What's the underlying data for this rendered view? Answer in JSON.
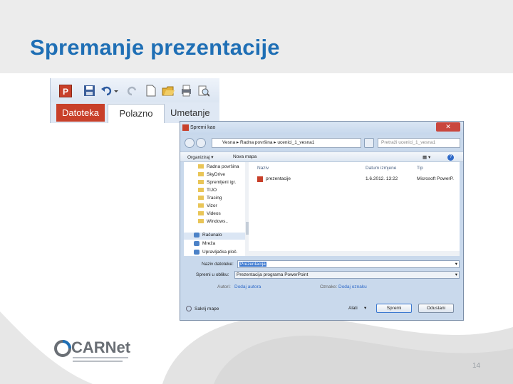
{
  "slide": {
    "title": "Spremanje prezentacije",
    "page_number": "14",
    "logo": "CARNet",
    "accent": "#1f6fb5"
  },
  "ribbon": {
    "app_icon": "powerpoint-icon",
    "quick_access_icons": [
      "save-icon",
      "undo-icon",
      "redo-icon",
      "new-icon",
      "open-icon",
      "print-icon",
      "print-preview-icon"
    ],
    "tabs": [
      "Datoteka",
      "Polazno",
      "Umetanje"
    ],
    "file_tab_color": "#c8402a"
  },
  "dialog": {
    "title": "Spremi kao",
    "address_path": "Vesna ▸ Radna površina ▸ ucenici_1_vesna1",
    "search_placeholder": "Pretraži ucenici_1_vesna1",
    "toolbar": {
      "organize": "Organiziraj ▾",
      "new_folder": "Nova mapa"
    },
    "tree_items": [
      "Radna površina",
      "SkyDrive",
      "Spremljeni igr.",
      "TIJO",
      "Tracing",
      "Vizor",
      "Videos",
      "Windows..",
      "Računalo",
      "Mreža",
      "Upravljačka ploč."
    ],
    "columns": [
      "Naziv",
      "Datum izmjene",
      "Tip"
    ],
    "files": [
      {
        "name": "prezentacije",
        "date": "1.6.2012. 13:22",
        "type": "Microsoft PowerP."
      }
    ],
    "file_name_label": "Naziv datoteke:",
    "file_name_value": "Prezentacija",
    "save_type_label": "Spremi u obliku:",
    "save_type_value": "Prezentacija programa PowerPoint",
    "authors_label": "Autori:",
    "authors_link": "Dodaj autora",
    "tags_label": "Oznake:",
    "tags_link": "Dodaj oznaku",
    "hide_folders": "Sakrij mape",
    "tools": "Alati",
    "save_button": "Spremi",
    "cancel_button": "Odustani"
  }
}
